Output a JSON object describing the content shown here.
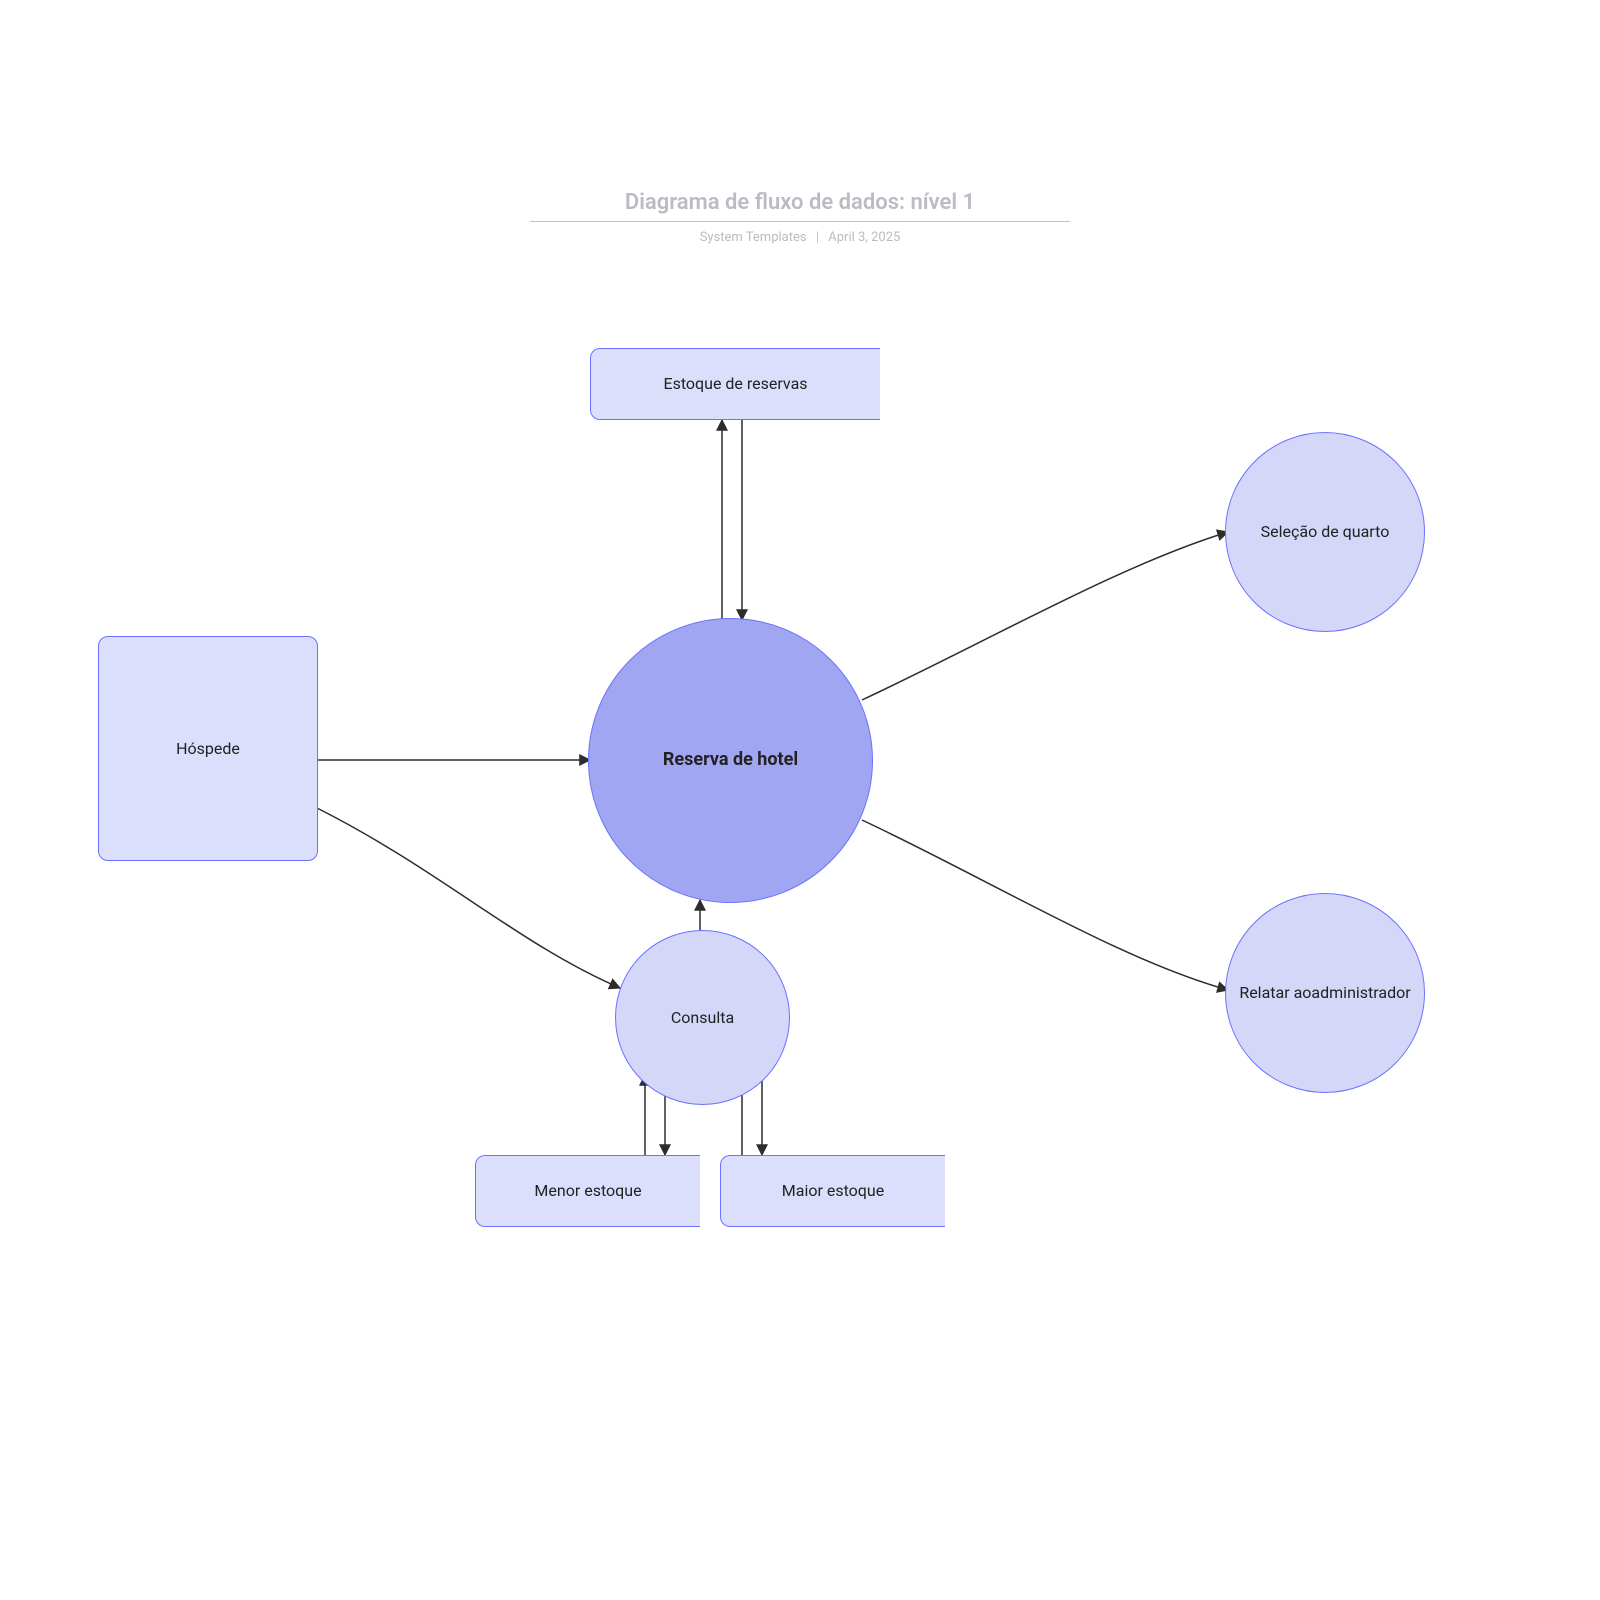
{
  "header": {
    "title": "Diagrama de fluxo de dados: nível 1",
    "source": "System Templates",
    "date": "April 3, 2025"
  },
  "nodes": {
    "guest": {
      "label": "Hóspede"
    },
    "reservation_stock": {
      "label": "Estoque de reservas"
    },
    "hotel_reservation": {
      "label": "Reserva de hotel"
    },
    "query": {
      "label": "Consulta"
    },
    "smaller_stock": {
      "label": "Menor estoque"
    },
    "larger_stock": {
      "label": "Maior estoque"
    },
    "room_selection": {
      "label": "Seleção de quarto"
    },
    "report_admin_line1": "Relatar ao",
    "report_admin_line2": "administrador"
  },
  "edges": [
    {
      "from": "guest",
      "to": "hotel_reservation",
      "arrow": "end"
    },
    {
      "from": "guest",
      "to": "query",
      "arrow": "end"
    },
    {
      "from": "hotel_reservation",
      "to": "reservation_stock",
      "arrow": "both"
    },
    {
      "from": "query",
      "to": "hotel_reservation",
      "arrow": "end"
    },
    {
      "from": "smaller_stock",
      "to": "query",
      "arrow": "both"
    },
    {
      "from": "larger_stock",
      "to": "query",
      "arrow": "both"
    },
    {
      "from": "hotel_reservation",
      "to": "room_selection",
      "arrow": "end"
    },
    {
      "from": "hotel_reservation",
      "to": "report_admin",
      "arrow": "end"
    }
  ],
  "colors": {
    "shape_fill_light": "#dcdffb",
    "shape_fill_main": "#a1a6f2",
    "stroke": "#6b72ff",
    "edge": "#2d2d2d"
  }
}
